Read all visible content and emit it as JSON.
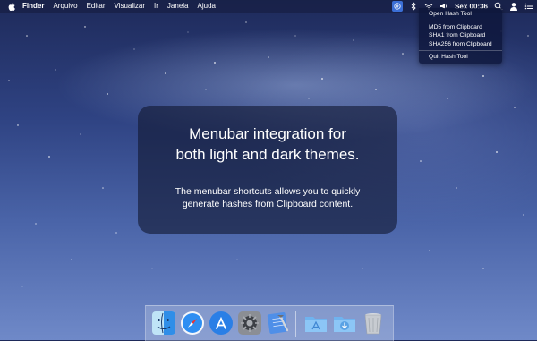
{
  "menubar": {
    "apple_icon": "apple-icon",
    "app_name": "Finder",
    "menus": [
      "Arquivo",
      "Editar",
      "Visualizar",
      "Ir",
      "Janela",
      "Ajuda"
    ],
    "clock": "Sex 00:36",
    "status_icons": [
      "hash-tool-icon",
      "bluetooth-icon",
      "wifi-icon",
      "volume-icon",
      "search-icon",
      "user-icon",
      "notification-list-icon"
    ]
  },
  "dropdown": {
    "open_label": "Open Hash Tool",
    "md5_label": "MD5 from Clipboard",
    "sha1_label": "SHA1 from Clipboard",
    "sha256_label": "SHA256 from Clipboard",
    "quit_label": "Quit Hash Tool"
  },
  "panel": {
    "headline_line1": "Menubar integration for",
    "headline_line2": "both light and dark themes.",
    "sub_line1": "The menubar shortcuts allows you to quickly",
    "sub_line2": "generate hashes from Clipboard content."
  },
  "dock": {
    "apps": [
      "finder-icon",
      "safari-icon",
      "app-store-icon",
      "system-preferences-icon",
      "xcode-icon"
    ],
    "folders": [
      "applications-folder-icon",
      "downloads-folder-icon",
      "trash-icon"
    ]
  },
  "colors": {
    "accent": "#3b6fd6",
    "wallpaper_top": "#1e2a5a",
    "wallpaper_bottom": "#6f89c8"
  }
}
